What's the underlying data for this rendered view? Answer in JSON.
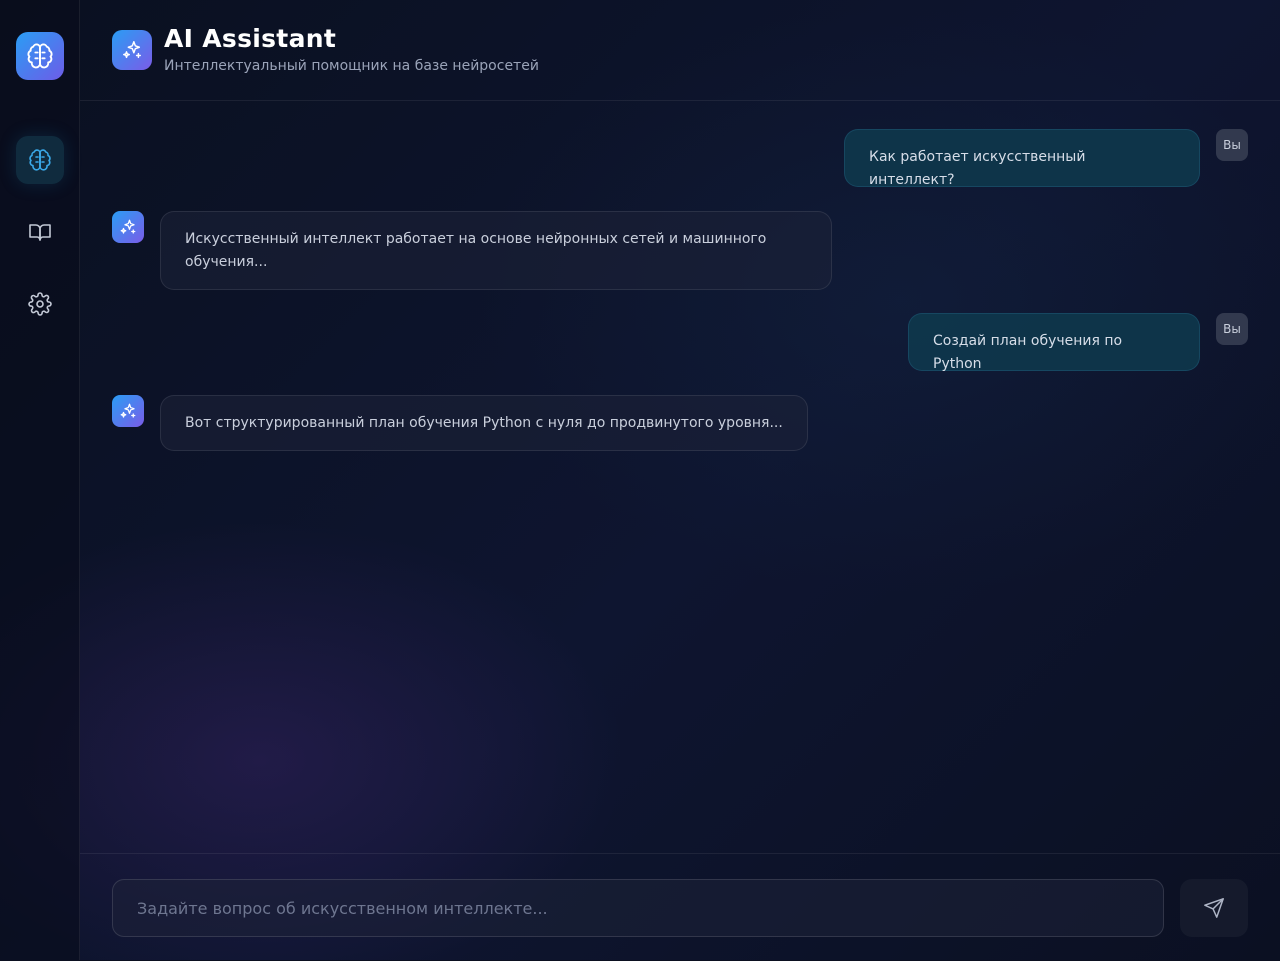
{
  "header": {
    "title": "AI Assistant",
    "subtitle": "Интеллектуальный помощник на базе нейросетей"
  },
  "sidebar": {
    "items": [
      {
        "icon": "brain-icon",
        "active": true
      },
      {
        "icon": "book-icon",
        "active": false
      },
      {
        "icon": "gear-icon",
        "active": false
      }
    ]
  },
  "messages": [
    {
      "role": "user",
      "badge": "Вы",
      "text": "Как работает искусственный интеллект?"
    },
    {
      "role": "ai",
      "text": "Искусственный интеллект работает на основе нейронных сетей и машинного обучения..."
    },
    {
      "role": "user",
      "badge": "Вы",
      "text": "Создай план обучения по Python"
    },
    {
      "role": "ai",
      "text": "Вот структурированный план обучения Python с нуля до продвинутого уровня..."
    }
  ],
  "composer": {
    "placeholder": "Задайте вопрос об искусственном интеллекте...",
    "value": ""
  },
  "colors": {
    "accent_from": "#2a9df4",
    "accent_to": "#7a5ce8",
    "user_bubble": "#0e3a4e",
    "background": "#0b1020"
  }
}
